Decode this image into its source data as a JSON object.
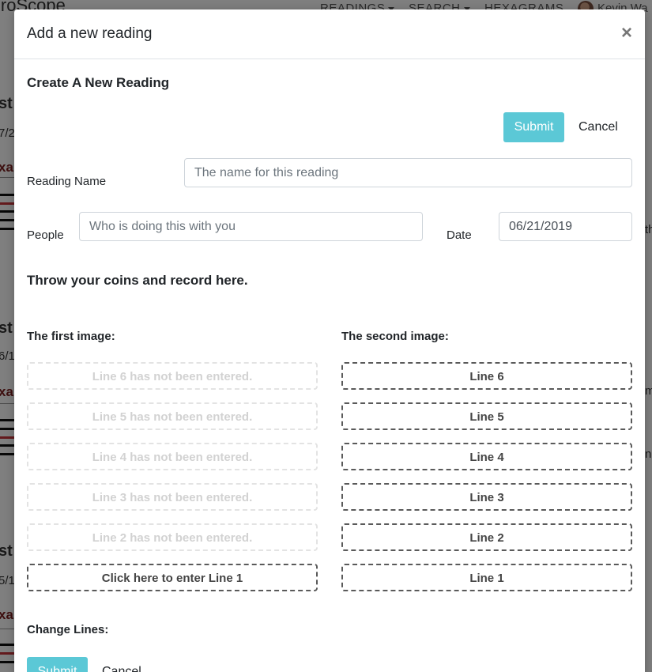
{
  "background": {
    "brand": "iroScope",
    "nav": [
      {
        "label": "READINGS",
        "caret": true
      },
      {
        "label": "SEARCH",
        "caret": true
      },
      {
        "label": "HEXAGRAMS",
        "caret": false
      }
    ],
    "user_name": "Kevin Wa",
    "fragments": [
      "st",
      "7/2",
      "xa",
      "st",
      "6/1",
      "xa",
      "st",
      "5/1",
      "xa",
      "th",
      "m",
      "n"
    ]
  },
  "modal": {
    "title": "Add a new reading",
    "close_label": "×",
    "form_title": "Create A New Reading",
    "submit_label": "Submit",
    "cancel_label": "Cancel",
    "reading_name": {
      "label": "Reading Name",
      "value": "",
      "placeholder": "The name for this reading"
    },
    "people": {
      "label": "People",
      "value": "",
      "placeholder": "Who is doing this with you"
    },
    "date": {
      "label": "Date",
      "value": "06/21/2019"
    },
    "coins_heading": "Throw your coins and record here.",
    "first_image": {
      "title": "The first image:",
      "lines": [
        "Line 6 has not been entered.",
        "Line 5 has not been entered.",
        "Line 4 has not been entered.",
        "Line 3 has not been entered.",
        "Line 2 has not been entered.",
        "Click here to enter Line 1"
      ]
    },
    "second_image": {
      "title": "The second image:",
      "lines": [
        "Line 6",
        "Line 5",
        "Line 4",
        "Line 3",
        "Line 2",
        "Line 1"
      ]
    },
    "change_lines": {
      "title": "Change Lines:",
      "submit_label": "Submit",
      "cancel_label": "Cancel"
    }
  }
}
